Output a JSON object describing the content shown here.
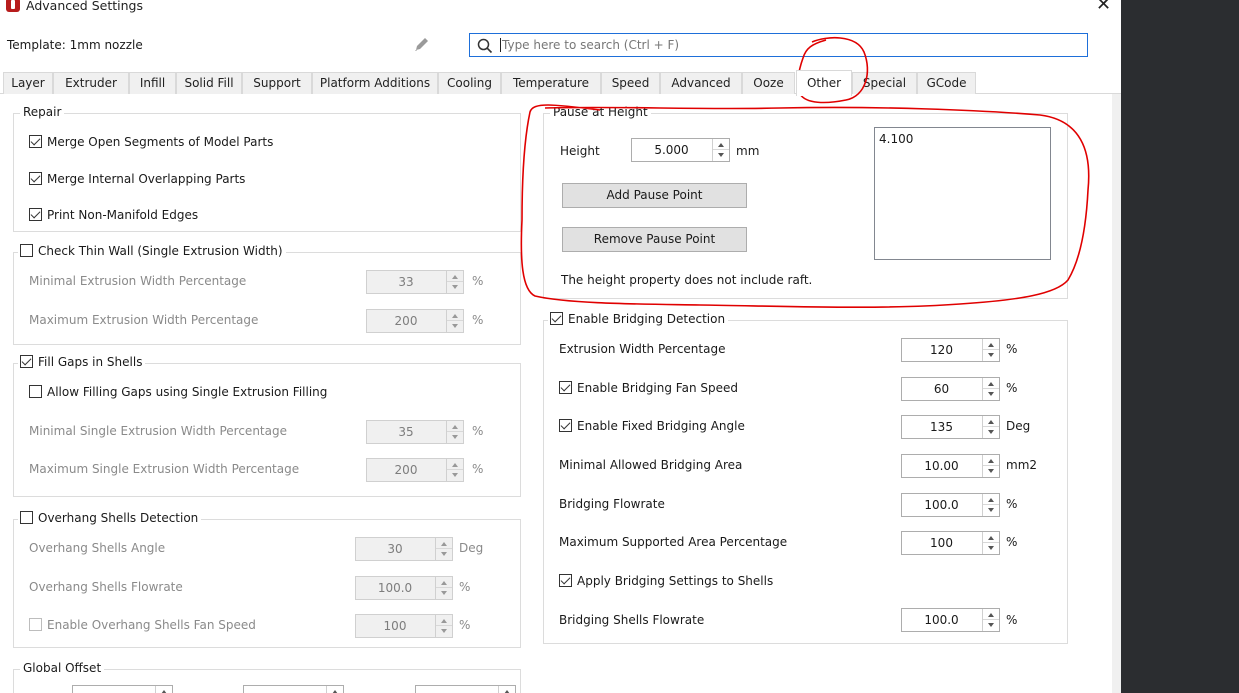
{
  "window": {
    "title": "Advanced Settings",
    "close_glyph": "✕"
  },
  "header": {
    "template_label": "Template: 1mm nozzle",
    "search_placeholder": "Type here to search (Ctrl + F)"
  },
  "tabs": [
    "Layer",
    "Extruder",
    "Infill",
    "Solid Fill",
    "Support",
    "Platform Additions",
    "Cooling",
    "Temperature",
    "Speed",
    "Advanced",
    "Ooze",
    "Other",
    "Special",
    "GCode"
  ],
  "active_tab": "Other",
  "repair": {
    "title": "Repair",
    "merge_open": {
      "label": "Merge Open Segments of Model Parts",
      "checked": true
    },
    "merge_internal": {
      "label": "Merge Internal Overlapping Parts",
      "checked": true
    },
    "print_nonmanifold": {
      "label": "Print Non-Manifold Edges",
      "checked": true
    }
  },
  "thin_wall": {
    "title": "Check Thin Wall (Single Extrusion Width)",
    "checked": false,
    "min_label": "Minimal Extrusion Width Percentage",
    "min_value": "33",
    "min_unit": "%",
    "max_label": "Maximum Extrusion Width Percentage",
    "max_value": "200",
    "max_unit": "%"
  },
  "fill_gaps": {
    "title": "Fill Gaps in Shells",
    "checked": true,
    "allow_label": "Allow Filling Gaps using Single Extrusion Filling",
    "allow_checked": false,
    "min_label": "Minimal Single Extrusion Width Percentage",
    "min_value": "35",
    "min_unit": "%",
    "max_label": "Maximum Single Extrusion Width Percentage",
    "max_value": "200",
    "max_unit": "%"
  },
  "overhang": {
    "title": "Overhang Shells Detection",
    "checked": false,
    "angle_label": "Overhang Shells Angle",
    "angle_value": "30",
    "angle_unit": "Deg",
    "flow_label": "Overhang Shells Flowrate",
    "flow_value": "100.0",
    "flow_unit": "%",
    "fan_label": "Enable Overhang Shells Fan Speed",
    "fan_value": "100",
    "fan_unit": "%",
    "fan_checked": false
  },
  "global_offset": {
    "title": "Global Offset"
  },
  "pause": {
    "title": "Pause at Height",
    "height_label": "Height",
    "height_value": "5.000",
    "height_unit": "mm",
    "add_button": "Add Pause Point",
    "remove_button": "Remove Pause Point",
    "note": "The height property does not include raft.",
    "points": [
      "4.100"
    ]
  },
  "bridging": {
    "title": "Enable Bridging Detection",
    "checked": true,
    "ext_width_label": "Extrusion Width Percentage",
    "ext_width_value": "120",
    "ext_width_unit": "%",
    "fan_label": "Enable Bridging Fan Speed",
    "fan_checked": true,
    "fan_value": "60",
    "fan_unit": "%",
    "angle_label": "Enable Fixed Bridging Angle",
    "angle_checked": true,
    "angle_value": "135",
    "angle_unit": "Deg",
    "min_area_label": "Minimal Allowed Bridging Area",
    "min_area_value": "10.00",
    "min_area_unit": "mm2",
    "flow_label": "Bridging Flowrate",
    "flow_value": "100.0",
    "flow_unit": "%",
    "max_area_label": "Maximum Supported Area Percentage",
    "max_area_value": "100",
    "max_area_unit": "%",
    "apply_label": "Apply Bridging Settings to Shells",
    "apply_checked": true,
    "shells_flow_label": "Bridging Shells Flowrate",
    "shells_flow_value": "100.0",
    "shells_flow_unit": "%"
  },
  "colors": {
    "annotation": "#e00000",
    "accent": "#1e6fd9",
    "app_icon": "#b71c1c"
  },
  "icons": [
    "app-icon",
    "close-icon",
    "pencil-icon",
    "search-icon",
    "checkbox-icon",
    "spin-arrows-icon"
  ]
}
